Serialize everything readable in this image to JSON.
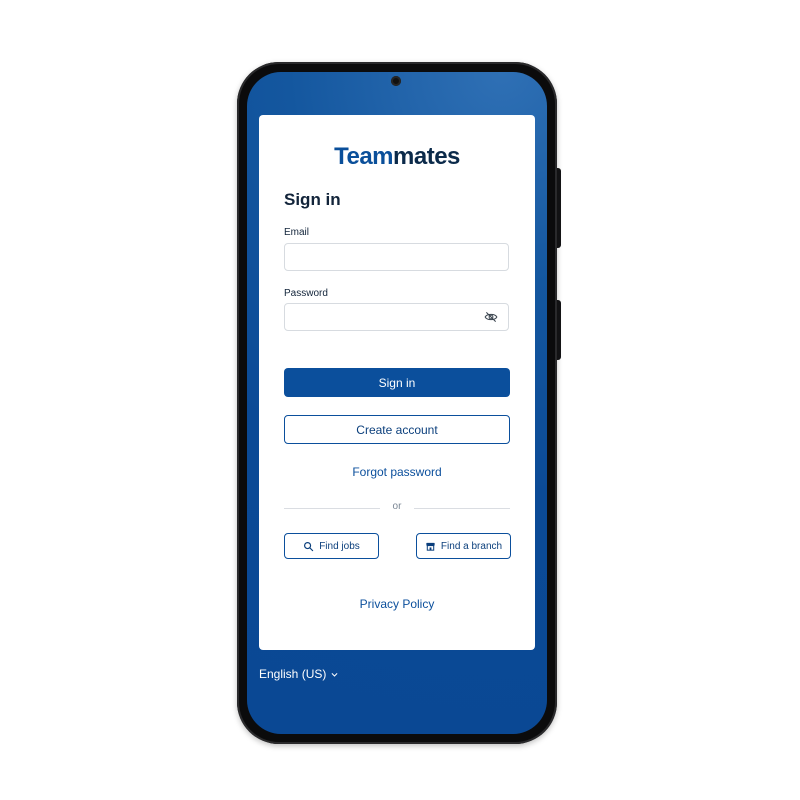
{
  "app": {
    "logo_text_1": "Team",
    "logo_text_2": "mates"
  },
  "signin": {
    "title": "Sign in",
    "email_label": "Email",
    "email_value": "",
    "password_label": "Password",
    "password_value": "",
    "sign_in_button": "Sign in",
    "create_account_button": "Create account",
    "forgot_password_link": "Forgot password",
    "or_text": "or",
    "find_jobs_button": "Find jobs",
    "find_branch_button": "Find a branch",
    "privacy_link": "Privacy Policy"
  },
  "footer": {
    "language": "English (US)"
  },
  "colors": {
    "primary": "#0b4f9c",
    "background_blue": "#0a4894",
    "text_dark": "#12243a"
  },
  "icons": [
    "eye-off-icon",
    "search-icon",
    "store-icon",
    "chevron-down-icon"
  ]
}
